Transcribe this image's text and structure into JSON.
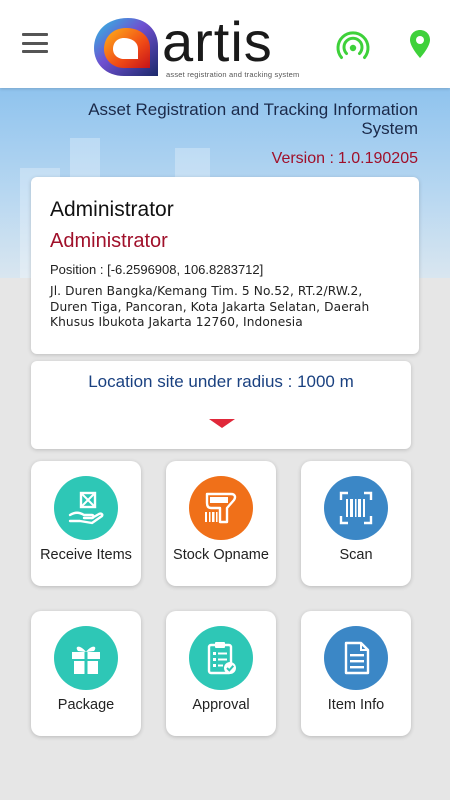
{
  "header": {
    "logo_word": "artis",
    "logo_tagline": "asset registration and tracking system",
    "menu_icon": "hamburger-menu-icon",
    "signal_icon": "signal-broadcast-icon",
    "location_icon": "map-pin-icon",
    "accent_color": "#3ed13a"
  },
  "hero": {
    "title": "Asset Registration and Tracking Information System",
    "version_label": "Version :",
    "version_value": "1.0.190205"
  },
  "user": {
    "name": "Administrator",
    "role": "Administrator",
    "position_label": "Position :",
    "position_value": "[-6.2596908, 106.8283712]",
    "address": "Jl. Duren Bangka/Kemang Tim. 5 No.52, RT.2/RW.2, Duren Tiga, Pancoran, Kota Jakarta Selatan, Daerah Khusus Ibukota Jakarta 12760, Indonesia"
  },
  "location": {
    "radius_text": "Location site under radius : 1000 m",
    "expand_icon": "triangle-down-icon"
  },
  "menu": [
    {
      "label": "Receive Items",
      "icon": "receive-items-icon",
      "color": "#2ec7b6"
    },
    {
      "label": "Stock Opname",
      "icon": "barcode-scanner-icon",
      "color": "#f07019"
    },
    {
      "label": "Scan",
      "icon": "barcode-scan-icon",
      "color": "#3b87c6"
    },
    {
      "label": "Package",
      "icon": "gift-box-icon",
      "color": "#2ec7b6"
    },
    {
      "label": "Approval",
      "icon": "clipboard-check-icon",
      "color": "#2ec7b6"
    },
    {
      "label": "Item Info",
      "icon": "document-info-icon",
      "color": "#3b87c6"
    }
  ],
  "colors": {
    "brand_red": "#a0102a",
    "radius_text": "#1a4180",
    "expand_arrow": "#e0283a"
  }
}
